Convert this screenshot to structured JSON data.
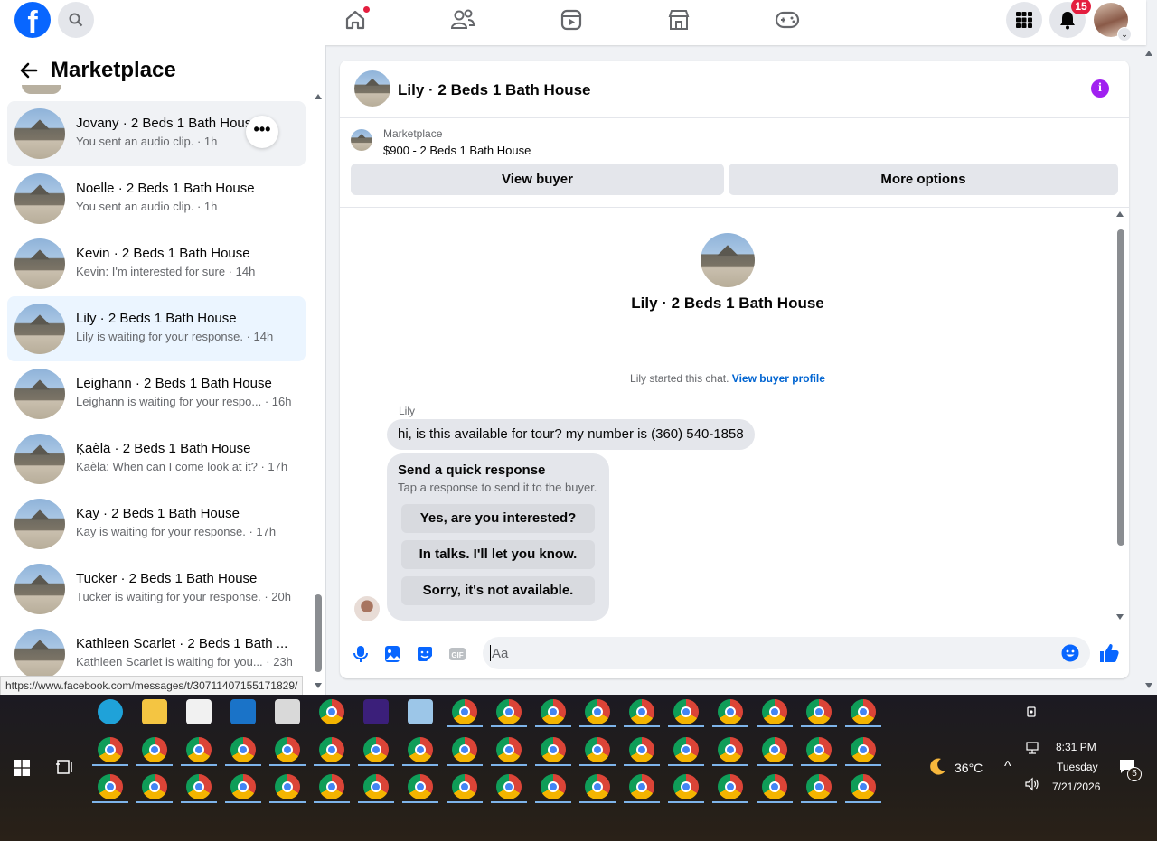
{
  "topbar": {
    "logo": "f",
    "notification_count": "15",
    "nav_icons": [
      "home-icon",
      "friends-icon",
      "watch-icon",
      "marketplace-icon",
      "gaming-icon"
    ]
  },
  "sidebar": {
    "title": "Marketplace",
    "conversations": [
      {
        "name": "Jovany · 2 Beds 1 Bath House",
        "snippet": "You sent an audio clip. · 1h",
        "state": "hover"
      },
      {
        "name": "Noelle · 2 Beds 1 Bath House",
        "snippet": "You sent an audio clip. · 1h",
        "state": ""
      },
      {
        "name": "Kevin · 2 Beds 1 Bath House",
        "snippet": "Kevin: I'm interested for sure · 14h",
        "state": ""
      },
      {
        "name": "Lily · 2 Beds 1 Bath House",
        "snippet": "Lily is waiting for your response. · 14h",
        "state": "active"
      },
      {
        "name": "Leighann · 2 Beds 1 Bath House",
        "snippet": "Leighann is waiting for your respo... · 16h",
        "state": ""
      },
      {
        "name": "Ķaèlä · 2 Beds 1 Bath House",
        "snippet": "Ķaèlä: When can I come look at it? · 17h",
        "state": ""
      },
      {
        "name": "Kay · 2 Beds 1 Bath House",
        "snippet": "Kay is waiting for your response. · 17h",
        "state": ""
      },
      {
        "name": "Tucker · 2 Beds 1 Bath House",
        "snippet": "Tucker is waiting for your response. · 20h",
        "state": ""
      },
      {
        "name": "Kathleen Scarlet · 2 Beds 1 Bath ...",
        "snippet": "Kathleen Scarlet is waiting for you... · 23h",
        "state": ""
      }
    ],
    "more_icon": "•••"
  },
  "status_url": "https://www.facebook.com/messages/t/30711407155171829/",
  "chat": {
    "title": "Lily · 2 Beds 1 Bath House",
    "info_icon": "i",
    "marketplace_label": "Marketplace",
    "listing": "$900 - 2 Beds 1 Bath House",
    "view_buyer": "View buyer",
    "more_options": "More options",
    "center_title": "Lily · 2 Beds 1 Bath House",
    "started_text": "Lily started this chat.",
    "buyer_profile_link": "View buyer profile",
    "sender": "Lily",
    "message": "hi, is this available for tour? my number is (360) 540-1858",
    "quick_title": "Send a quick response",
    "quick_sub": "Tap a response to send it to the buyer.",
    "quick_responses": [
      "Yes, are you interested?",
      "In talks. I'll let you know.",
      "Sorry, it's not available."
    ],
    "composer_placeholder": "Aa"
  },
  "tray": {
    "weather": "36°C",
    "time": "8:31 PM",
    "day": "Tuesday",
    "date": "7/21/2026",
    "notif_count": "5"
  },
  "colors": {
    "brand": "#0866ff",
    "accent_link": "#0064d1",
    "info": "#a020f0",
    "badge": "#e41e3f"
  }
}
